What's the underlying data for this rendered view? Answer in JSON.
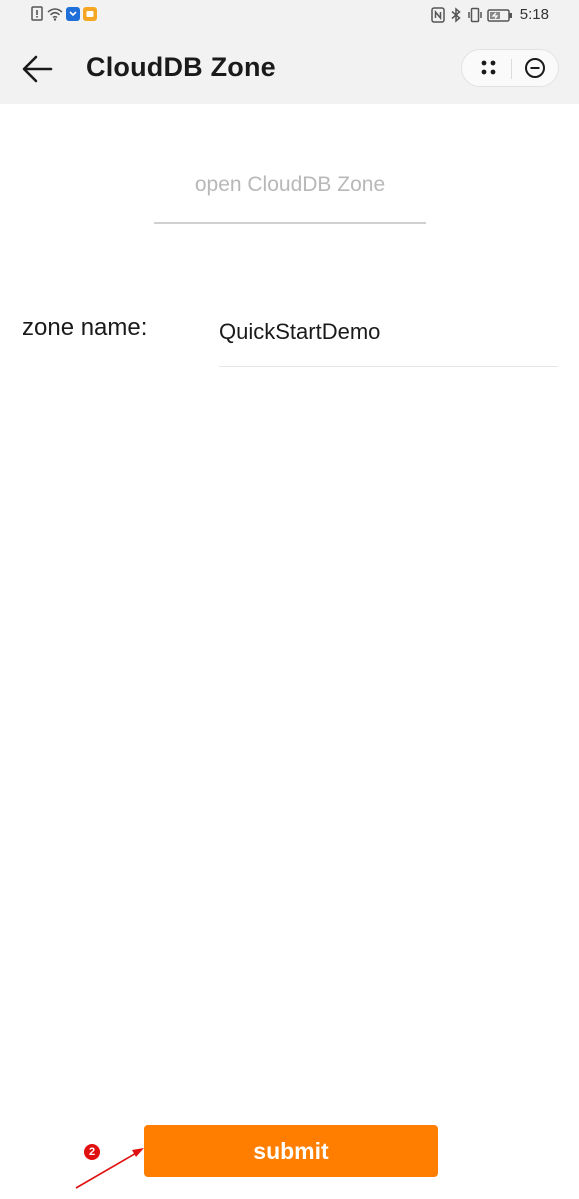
{
  "status_bar": {
    "time": "5:18",
    "left_icons": [
      "alert-icon",
      "wifi-icon",
      "app-badge-icon",
      "notification-icon"
    ],
    "right_icons": [
      "nfc-icon",
      "bluetooth-icon",
      "vibrate-icon",
      "battery-icon"
    ]
  },
  "header": {
    "title": "CloudDB Zone"
  },
  "main": {
    "open_button_label": "open CloudDB Zone",
    "zone_label": "zone name:",
    "zone_value": "QuickStartDemo"
  },
  "footer": {
    "submit_label": "submit"
  },
  "annotation": {
    "step_number": "2"
  },
  "colors": {
    "accent": "#ff7e00",
    "header_bg": "#f2f2f2",
    "annotation": "#e01010"
  }
}
